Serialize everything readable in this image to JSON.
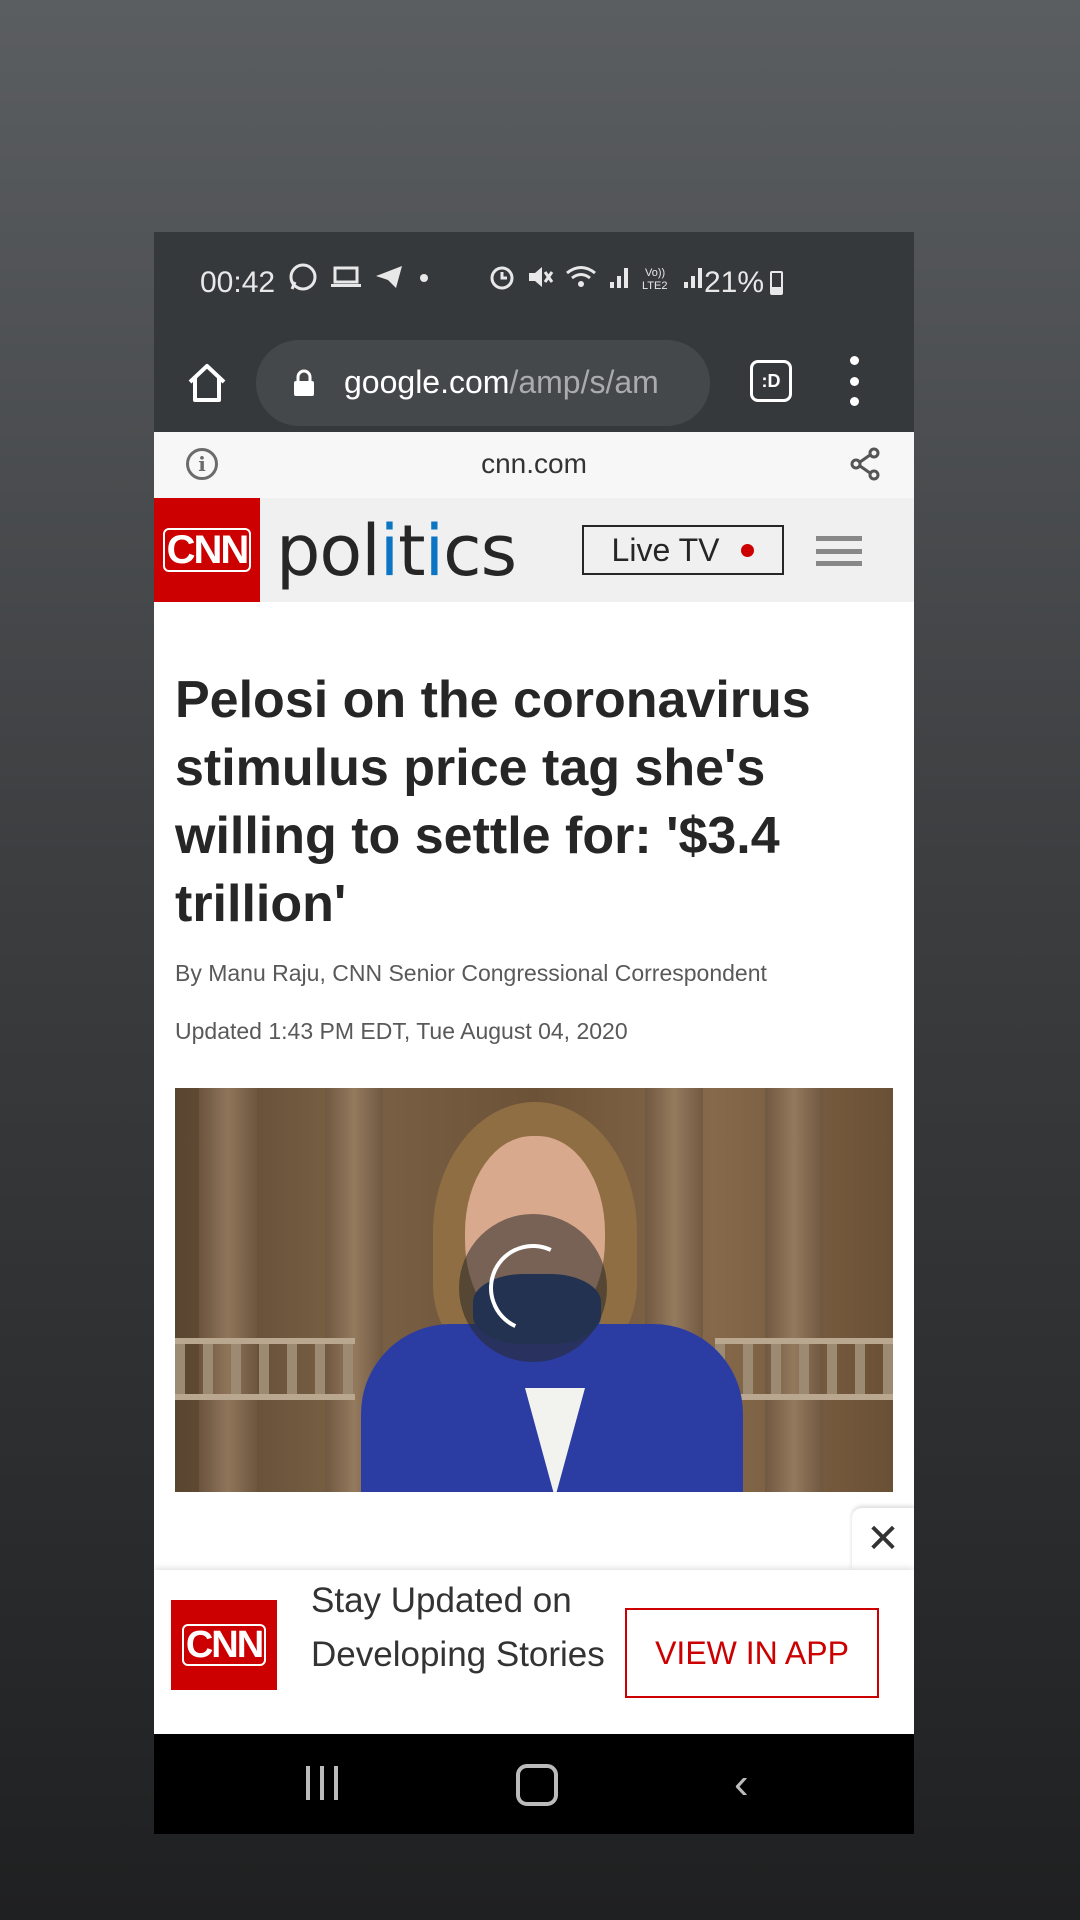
{
  "status_bar": {
    "time": "00:42",
    "battery": "21%",
    "icons_left": [
      "whatsapp-icon",
      "laptop-icon",
      "telegram-icon",
      "dot-icon"
    ],
    "icons_right": [
      "alarm-icon",
      "mute-icon",
      "wifi-icon",
      "signal-icon",
      "volte-icon",
      "signal-icon"
    ]
  },
  "browser": {
    "url_host": "google.com",
    "url_path": "/amp/s/am",
    "tabs_label": ":D"
  },
  "amp_bar": {
    "domain": "cnn.com"
  },
  "cnn_header": {
    "logo": "CNN",
    "section_pre": "pol",
    "section_i": "i",
    "section_mid": "t",
    "section_i2": "i",
    "section_post": "cs",
    "live_tv": "Live TV",
    "colors": {
      "brand_red": "#cc0000",
      "accent_blue": "#0c75c3"
    }
  },
  "article": {
    "headline": "Pelosi on the coronavirus stimulus price tag she's willing to settle for: '$3.4 trillion'",
    "byline": "By Manu Raju, CNN Senior Congressional Correspondent",
    "updated": "Updated 1:43 PM EDT, Tue August 04, 2020"
  },
  "banner": {
    "logo": "CNN",
    "text": "Stay Updated on Developing Stories",
    "button": "VIEW IN APP",
    "close": "✕"
  }
}
